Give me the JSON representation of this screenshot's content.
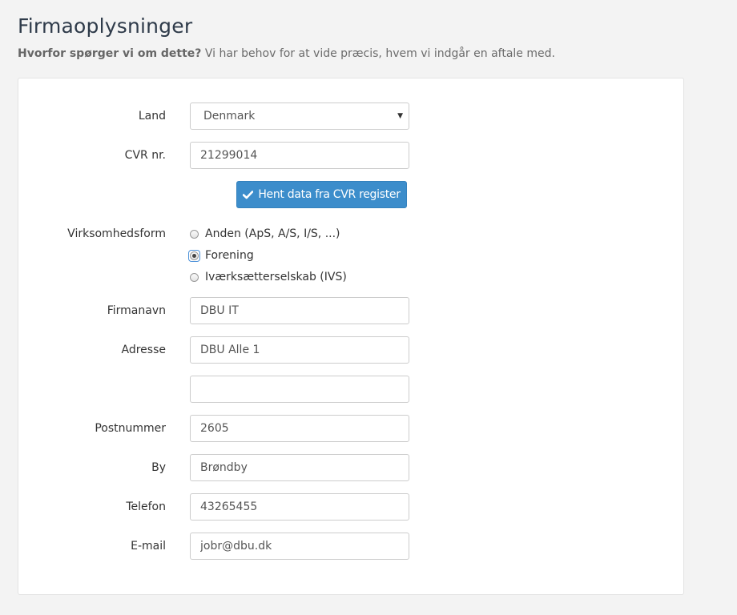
{
  "header": {
    "title": "Firmaoplysninger",
    "subtitle_bold": "Hvorfor spørger vi om dette?",
    "subtitle_text": " Vi har behov for at vide præcis, hvem vi indgår en aftale med."
  },
  "form": {
    "land": {
      "label": "Land",
      "value": "Denmark"
    },
    "cvr": {
      "label": "CVR nr.",
      "value": "21299014"
    },
    "fetch_button": {
      "label": "Hent data fra CVR register",
      "icon": "check-icon"
    },
    "virksomhedsform": {
      "label": "Virksomhedsform",
      "options": [
        {
          "label": "Anden (ApS, A/S, I/S, ...)",
          "checked": false
        },
        {
          "label": "Forening",
          "checked": true
        },
        {
          "label": "Iværksætterselskab (IVS)",
          "checked": false
        }
      ]
    },
    "firmanavn": {
      "label": "Firmanavn",
      "value": "DBU IT"
    },
    "adresse": {
      "label": "Adresse",
      "value": "DBU Alle 1"
    },
    "adresse2": {
      "value": ""
    },
    "postnummer": {
      "label": "Postnummer",
      "value": "2605"
    },
    "by": {
      "label": "By",
      "value": "Brøndby"
    },
    "telefon": {
      "label": "Telefon",
      "value": "43265455"
    },
    "email": {
      "label": "E-mail",
      "value": "jobr@dbu.dk"
    }
  },
  "colors": {
    "primary_button": "#3c8dcb",
    "title": "#2f3b4a",
    "background": "#f3f3f3"
  }
}
